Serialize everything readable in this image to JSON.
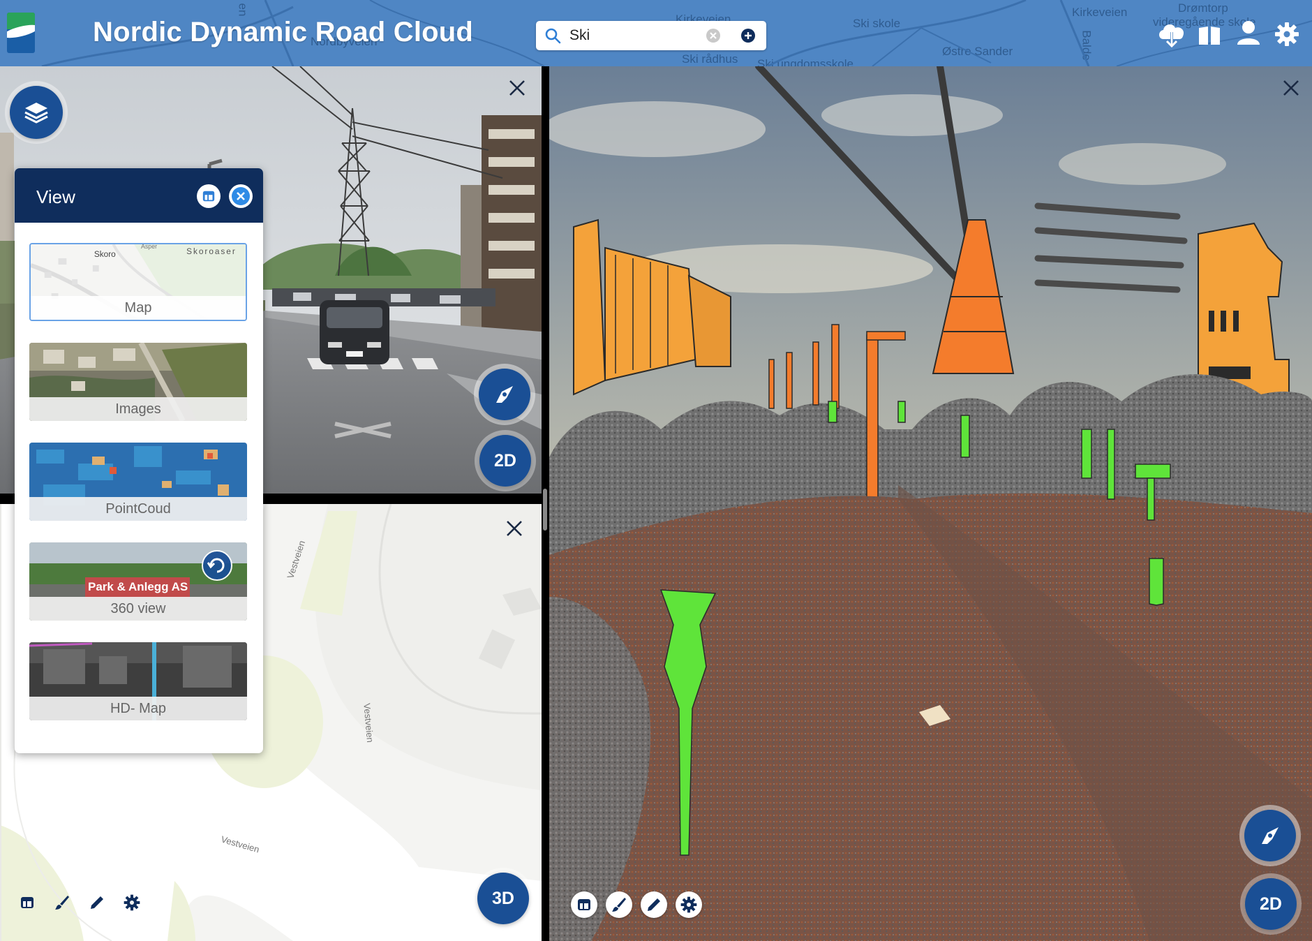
{
  "header": {
    "app_title": "Nordic Dynamic Road Cloud",
    "search_value": "Ski",
    "map_labels": [
      "Nordbyveien",
      "Kirkeveien",
      "Ski skole",
      "Kirkeveien",
      "Drømtorp",
      "videregående skole",
      "Østre Sander",
      "Ski rådhus",
      "Ski ungdomsskole",
      "Balde",
      "en"
    ]
  },
  "view_panel": {
    "title": "View",
    "cards": [
      {
        "label": "Map",
        "active": true,
        "thumb_labels": [
          "Skoro",
          "Skoroaser",
          "Asper"
        ]
      },
      {
        "label": "Images",
        "active": false
      },
      {
        "label": "PointCoud",
        "active": false
      },
      {
        "label": "360 view",
        "active": false,
        "sign_text": "Park & Anlegg AS"
      },
      {
        "label": "HD- Map",
        "active": false
      }
    ]
  },
  "map_pane": {
    "road_labels": [
      "Vestveien",
      "Vestveien",
      "Vestveien"
    ],
    "mode_button": "3D"
  },
  "street_pane": {
    "mode_button": "2D"
  },
  "cloud_pane": {
    "mode_button": "2D"
  },
  "colors": {
    "header_bg": "#4f86c4",
    "panel_header": "#0f2d5c",
    "accent": "#1a4f95",
    "cloud_orange": "#f47c2c",
    "cloud_green": "#5fe43a",
    "cloud_building": "#f4a23a"
  },
  "icons": {
    "header": [
      "cloud-download-icon",
      "book-icon",
      "user-icon",
      "gear-icon"
    ],
    "tools": [
      "layout-icon",
      "brush-icon",
      "pencil-icon",
      "gear-icon"
    ]
  }
}
